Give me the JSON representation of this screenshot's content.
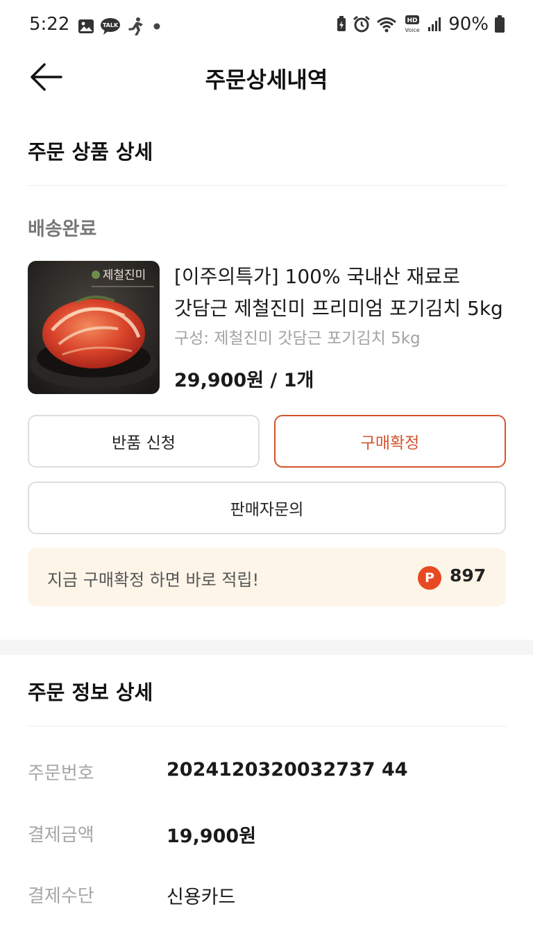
{
  "status_bar": {
    "time": "5:22",
    "battery_pct": "90%",
    "left_icons": [
      "image-icon",
      "kakaotalk-icon",
      "runner-icon",
      "dot-icon"
    ],
    "talk_badge": "TALK",
    "right_icons": [
      "battery-saver-icon",
      "alarm-icon",
      "wifi-icon",
      "hd-voice-icon",
      "signal-icon",
      "battery-icon"
    ],
    "hd_label": "HD",
    "voice_label": "Voice"
  },
  "header": {
    "title": "주문상세내역",
    "back_icon": "arrow-left-icon"
  },
  "order_product": {
    "section_title": "주문 상품 상세",
    "delivery_status": "배송완료",
    "product": {
      "image_brand_text": "제철진미",
      "name_line1": "[이주의특가] 100% 국내산 재료로",
      "name_line2": "갓담근 제철진미 프리미엄 포기김치 5kg",
      "option": "구성: 제철진미 갓담근 포기김치 5kg",
      "price": "29,900원 / 1개"
    },
    "buttons": {
      "return": "반품 신청",
      "confirm": "구매확정",
      "inquiry": "판매자문의"
    },
    "points_banner": {
      "text": "지금 구매확정 하면 바로 적립!",
      "icon_letter": "P",
      "points": "897"
    }
  },
  "order_info": {
    "section_title": "주문 정보 상세",
    "rows": [
      {
        "label": "주문번호",
        "value": "2024120320032737 44"
      },
      {
        "label": "결제금액",
        "value": "19,900원"
      },
      {
        "label": "결제수단",
        "value": "신용카드"
      }
    ]
  },
  "colors": {
    "accent": "#d4532e",
    "points_bg": "#fdf5e8",
    "points_icon": "#e74a22",
    "muted_text": "#a6a6a6"
  }
}
